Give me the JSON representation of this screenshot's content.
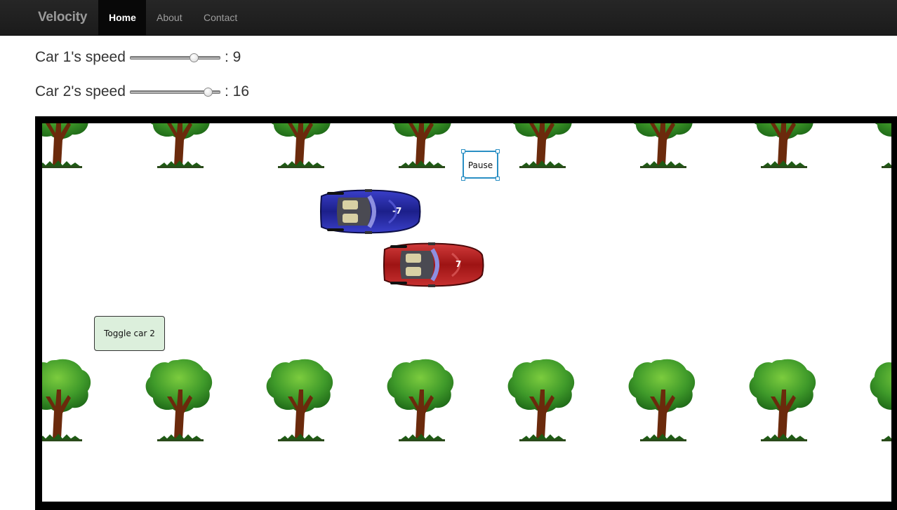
{
  "navbar": {
    "brand": "Velocity",
    "items": [
      {
        "label": "Home",
        "active": true
      },
      {
        "label": "About",
        "active": false
      },
      {
        "label": "Contact",
        "active": false
      }
    ]
  },
  "car1": {
    "label": "Car 1's speed",
    "value_text": ": 9",
    "slider_fraction": 0.7
  },
  "car2": {
    "label": "Car 2's speed",
    "value_text": ": 16",
    "slider_fraction": 0.85
  },
  "game": {
    "pause_label": "Pause",
    "toggle_label": "Toggle car 2",
    "blue_car_value": "-7",
    "red_car_value": "7"
  },
  "colors": {
    "navbar_bg": "#222222",
    "blue_car": "#1c1f8a",
    "red_car": "#9e1414",
    "tree_canopy": "#3f9a2a",
    "tree_trunk": "#6b2a0c",
    "toggle_bg": "#dcefdc",
    "pause_border": "#2a8fc4"
  }
}
